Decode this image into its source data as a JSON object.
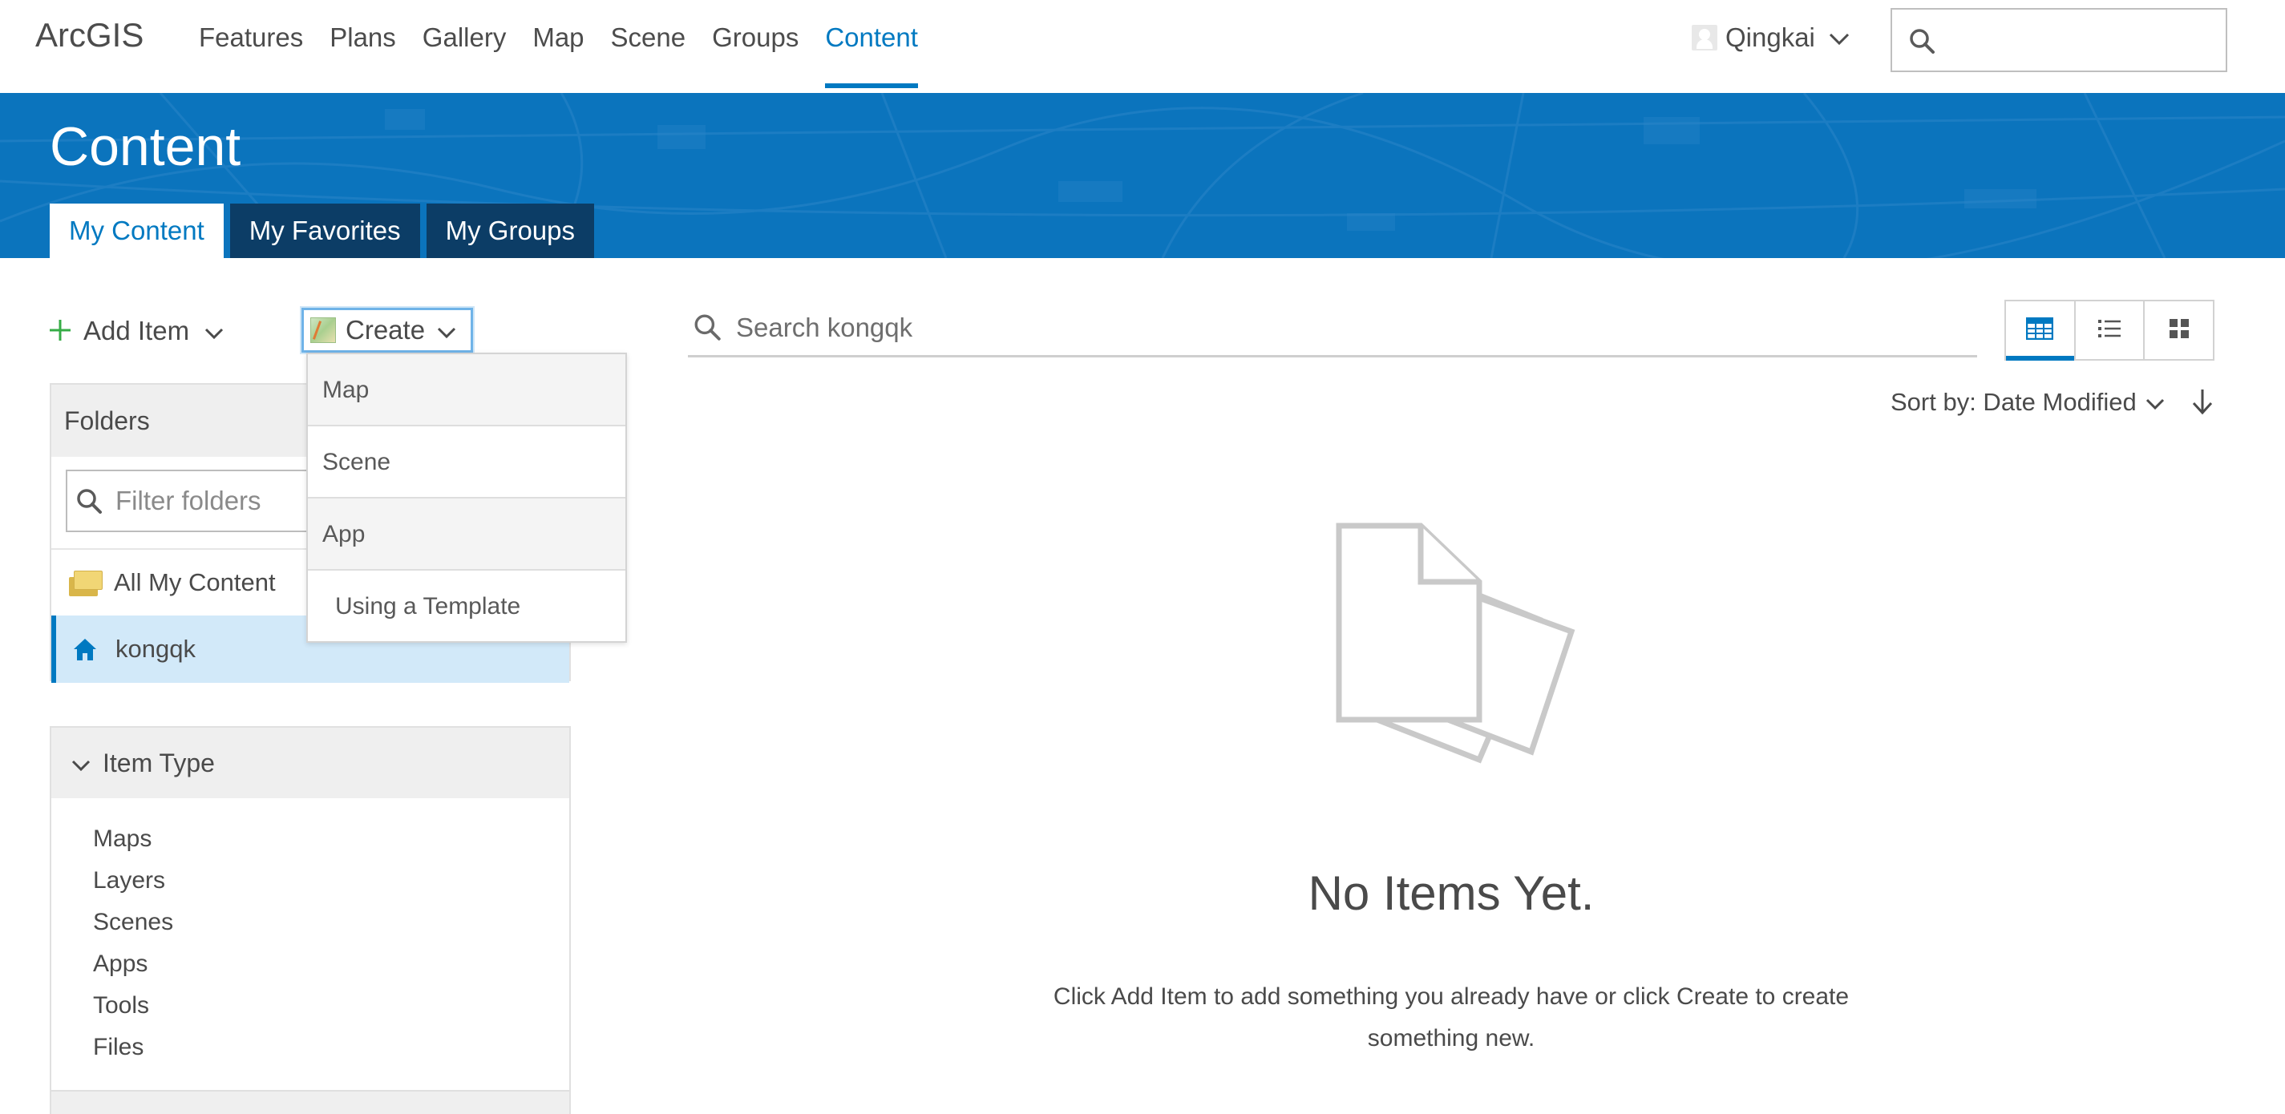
{
  "app": {
    "logo": "ArcGIS"
  },
  "nav": {
    "links": [
      "Features",
      "Plans",
      "Gallery",
      "Map",
      "Scene",
      "Groups",
      "Content"
    ],
    "active": "Content",
    "user_name": "Qingkai"
  },
  "banner": {
    "title": "Content",
    "tabs": [
      "My Content",
      "My Favorites",
      "My Groups"
    ],
    "active_tab": "My Content"
  },
  "toolbar": {
    "add_item_label": "Add Item",
    "create_label": "Create"
  },
  "create_menu": {
    "items": [
      "Map",
      "Scene",
      "App"
    ],
    "template_label": "Using a Template"
  },
  "folders": {
    "title": "Folders",
    "filter_placeholder": "Filter folders",
    "all_label": "All My Content",
    "home_label": "kongqk"
  },
  "item_type": {
    "title": "Item Type",
    "types": [
      "Maps",
      "Layers",
      "Scenes",
      "Apps",
      "Tools",
      "Files"
    ]
  },
  "main": {
    "search_placeholder": "Search kongqk",
    "sort_label": "Sort by: Date Modified",
    "empty_title": "No Items Yet.",
    "empty_line1": "Click Add Item to add something you already have or click Create to create",
    "empty_line2": "something new."
  },
  "colors": {
    "brand_blue": "#0079c1",
    "banner": "#0b74bd",
    "tab_dark": "#0c3d66",
    "plus_green": "#35ac46",
    "selected_row": "#d2e9f9"
  }
}
